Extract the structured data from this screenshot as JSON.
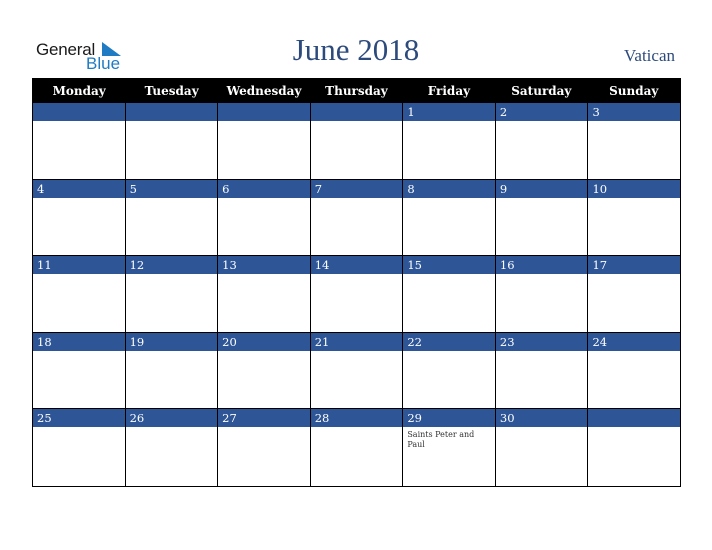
{
  "logo": {
    "line1": "General",
    "line2": "Blue"
  },
  "header": {
    "title": "June 2018",
    "country": "Vatican"
  },
  "colors": {
    "accent": "#2e5596",
    "title": "#2c4a7c",
    "logo_blue": "#1f7bc2",
    "header_bg": "#000000"
  },
  "weekdays": [
    "Monday",
    "Tuesday",
    "Wednesday",
    "Thursday",
    "Friday",
    "Saturday",
    "Sunday"
  ],
  "weeks": [
    [
      {
        "day": ""
      },
      {
        "day": ""
      },
      {
        "day": ""
      },
      {
        "day": ""
      },
      {
        "day": "1"
      },
      {
        "day": "2"
      },
      {
        "day": "3"
      }
    ],
    [
      {
        "day": "4"
      },
      {
        "day": "5"
      },
      {
        "day": "6"
      },
      {
        "day": "7"
      },
      {
        "day": "8"
      },
      {
        "day": "9"
      },
      {
        "day": "10"
      }
    ],
    [
      {
        "day": "11"
      },
      {
        "day": "12"
      },
      {
        "day": "13"
      },
      {
        "day": "14"
      },
      {
        "day": "15"
      },
      {
        "day": "16"
      },
      {
        "day": "17"
      }
    ],
    [
      {
        "day": "18"
      },
      {
        "day": "19"
      },
      {
        "day": "20"
      },
      {
        "day": "21"
      },
      {
        "day": "22"
      },
      {
        "day": "23"
      },
      {
        "day": "24"
      }
    ],
    [
      {
        "day": "25"
      },
      {
        "day": "26"
      },
      {
        "day": "27"
      },
      {
        "day": "28"
      },
      {
        "day": "29",
        "holiday": "Saints Peter and Paul"
      },
      {
        "day": "30"
      },
      {
        "day": ""
      }
    ]
  ]
}
